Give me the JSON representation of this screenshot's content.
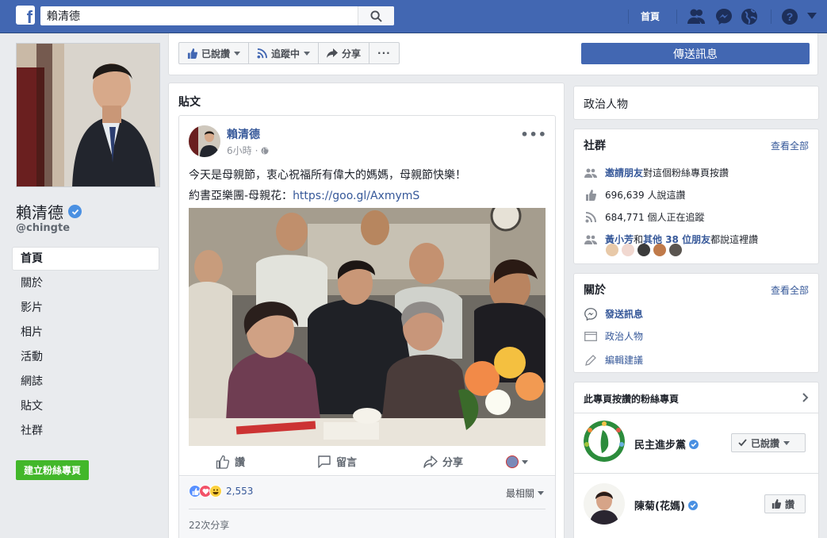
{
  "topbar": {
    "search_value": "賴清德",
    "home_label": "首頁"
  },
  "page": {
    "name": "賴清德",
    "handle": "@chingte"
  },
  "left_nav": [
    "首頁",
    "關於",
    "影片",
    "相片",
    "活動",
    "網誌",
    "貼文",
    "社群"
  ],
  "create_page_label": "建立粉絲專頁",
  "actions": {
    "liked": "已說讚",
    "following": "追蹤中",
    "share": "分享",
    "more": "···",
    "send_message": "傳送訊息"
  },
  "posts": {
    "section_title": "貼文",
    "author": "賴清德",
    "time": "6小時",
    "text_line1": "今天是母親節，衷心祝福所有偉大的媽媽，母親節快樂！",
    "text_line2_prefix": "約書亞樂團-母親花：",
    "text_link": "https://goo.gl/AxmymS",
    "like_label": "讚",
    "comment_label": "留言",
    "share_label": "分享",
    "reaction_count": "2,553",
    "sort_label": "最相關",
    "shares_label": "22次分享"
  },
  "category_box": {
    "label": "政治人物"
  },
  "community": {
    "title": "社群",
    "see_all": "查看全部",
    "invite_link": "邀請朋友",
    "invite_rest": "對這個粉絲專頁按讚",
    "likes": "696,639 人說這讚",
    "follows": "684,771 個人正在追蹤",
    "friend_name": "黃小芳",
    "friend_and": "和",
    "friend_others": "其他 38 位朋友",
    "friend_rest": "都說這裡讚"
  },
  "about": {
    "title": "關於",
    "see_all": "查看全部",
    "send_message": "發送訊息",
    "category": "政治人物",
    "suggest_edit": "編輯建議"
  },
  "liked_pages": {
    "title": "此專頁按讚的粉絲專頁",
    "items": [
      {
        "name": "民主進步黨",
        "button": "已說讚"
      },
      {
        "name": "陳菊(花媽)",
        "button": "讚"
      }
    ]
  },
  "colors": {
    "brand": "#4267b2",
    "link": "#365899",
    "green": "#42b72a",
    "background": "#e9ebee"
  }
}
